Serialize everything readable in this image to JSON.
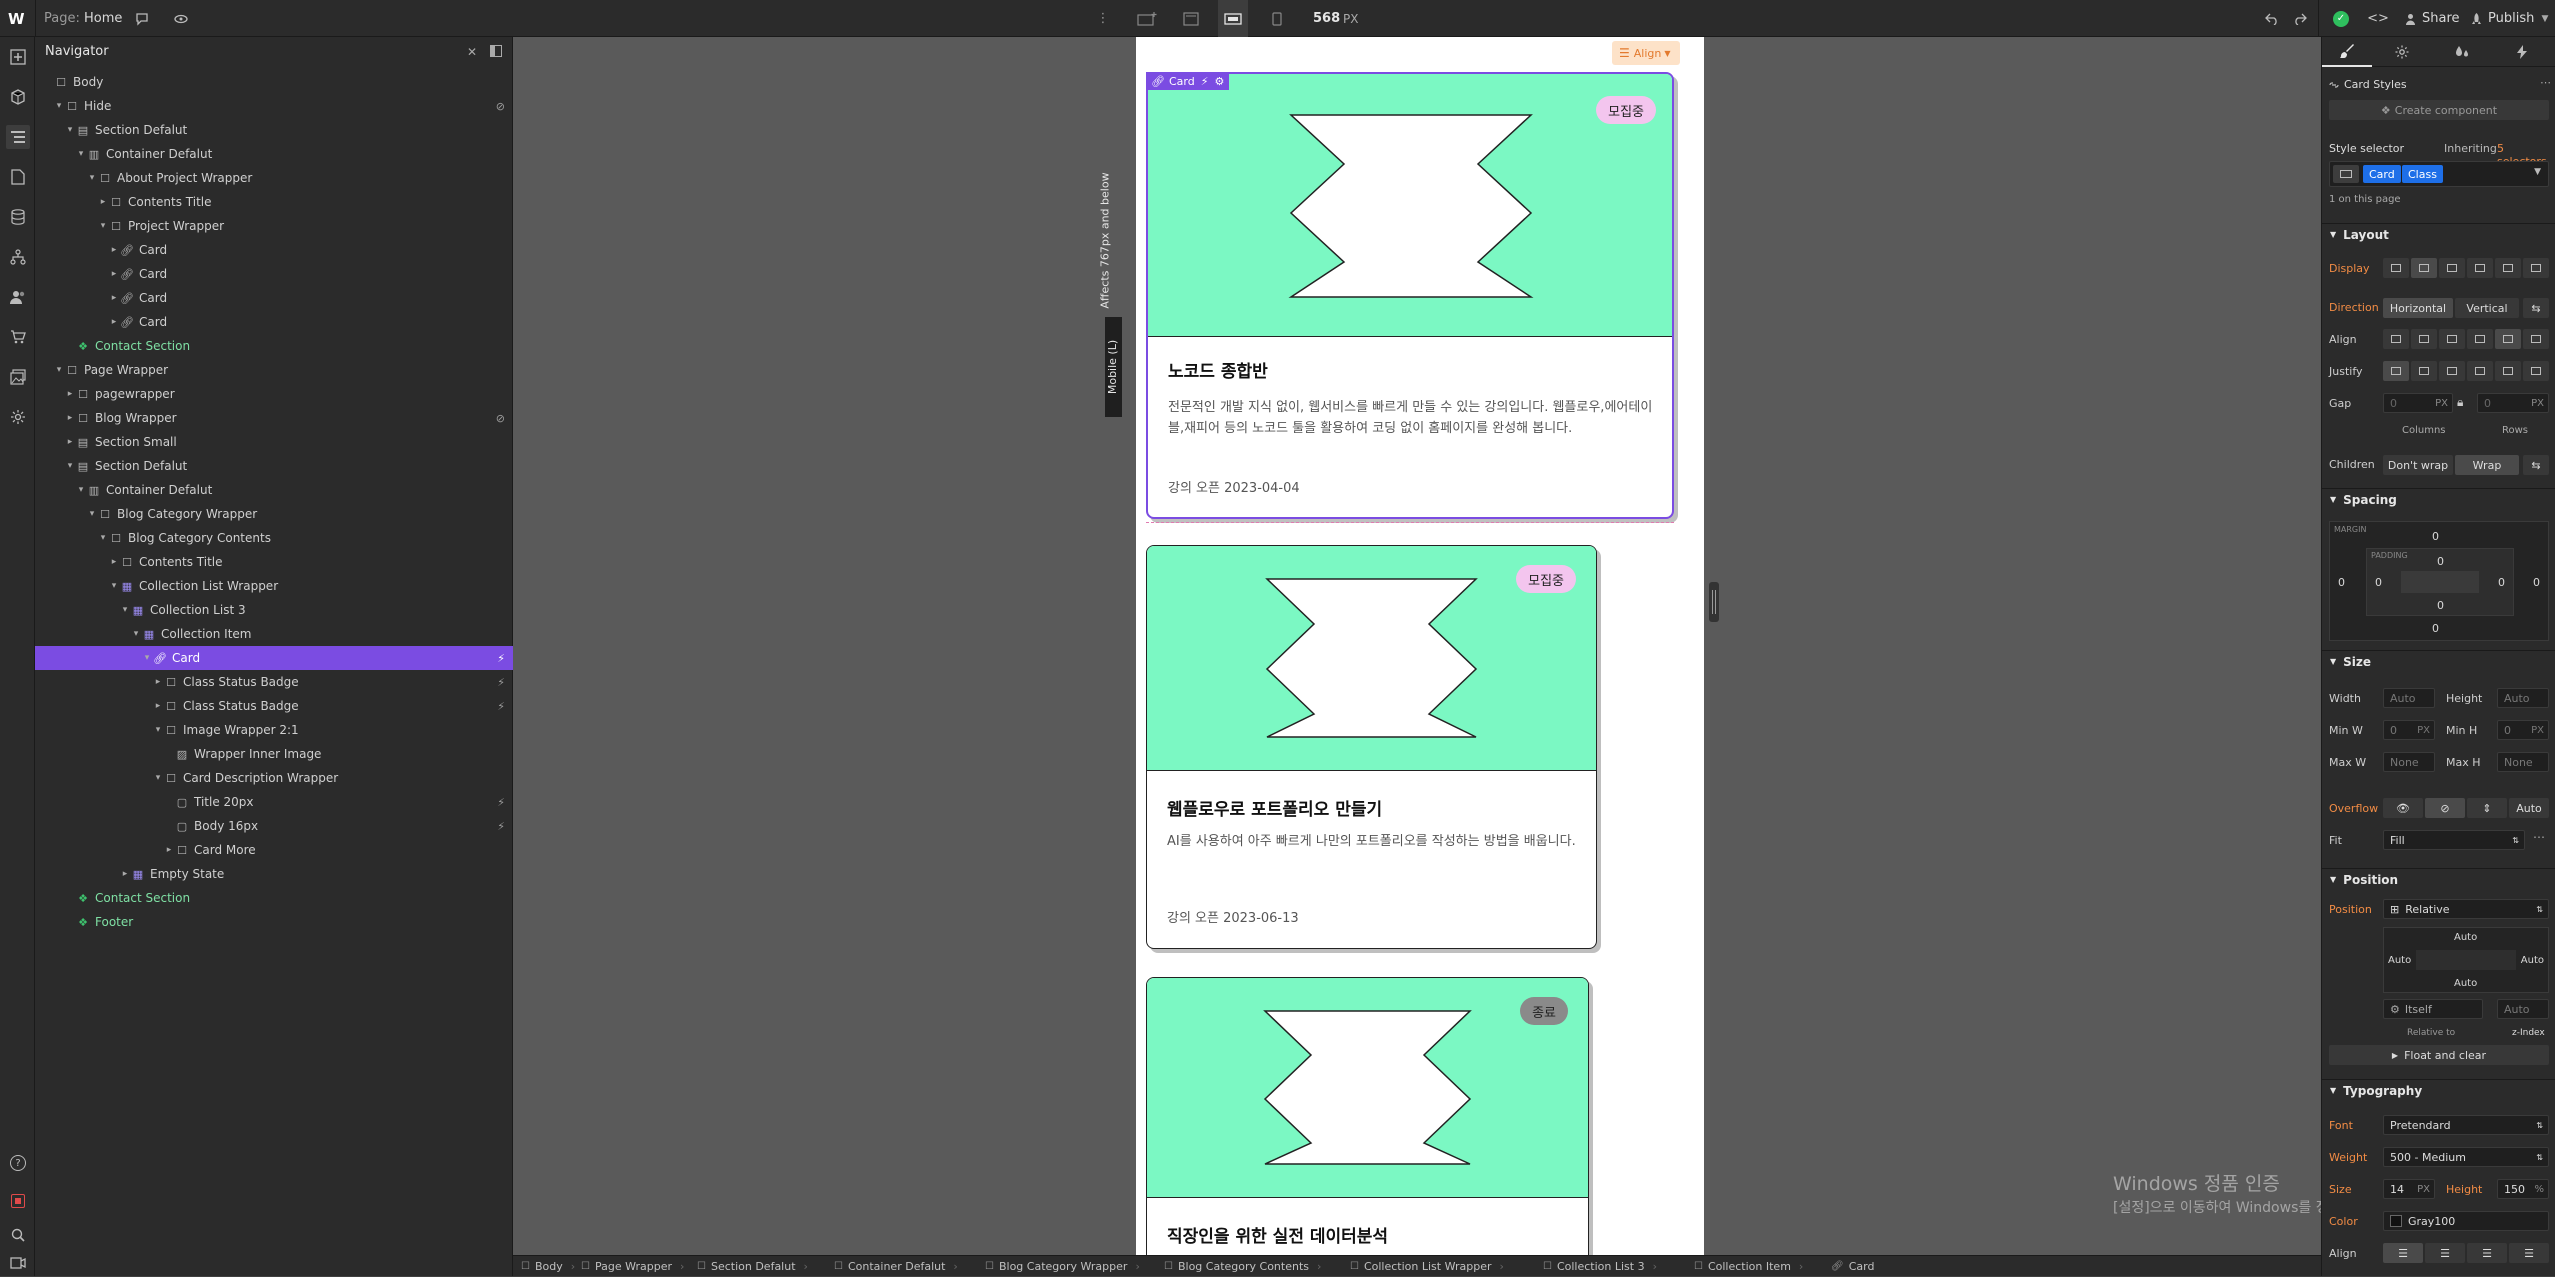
{
  "topbar": {
    "logo": "W",
    "page_prefix": "Page:",
    "page_name": "Home",
    "width_value": "568",
    "width_unit": "PX",
    "share_label": "Share",
    "publish_label": "Publish"
  },
  "navigator": {
    "title": "Navigator",
    "items": [
      {
        "label": "Body",
        "depth": 0,
        "type": "box"
      },
      {
        "label": "Hide",
        "depth": 1,
        "type": "box",
        "open": true,
        "hidden": true
      },
      {
        "label": "Section Defalut",
        "depth": 2,
        "type": "section",
        "open": true
      },
      {
        "label": "Container Defalut",
        "depth": 3,
        "type": "container",
        "open": true
      },
      {
        "label": "About Project Wrapper",
        "depth": 4,
        "type": "box",
        "open": true
      },
      {
        "label": "Contents Title",
        "depth": 5,
        "type": "box",
        "closed": true
      },
      {
        "label": "Project Wrapper",
        "depth": 5,
        "type": "box",
        "open": true
      },
      {
        "label": "Card",
        "depth": 6,
        "type": "link",
        "closed": true
      },
      {
        "label": "Card",
        "depth": 6,
        "type": "link",
        "closed": true
      },
      {
        "label": "Card",
        "depth": 6,
        "type": "link",
        "closed": true
      },
      {
        "label": "Card",
        "depth": 6,
        "type": "link",
        "closed": true
      },
      {
        "label": "Contact Section",
        "depth": 2,
        "type": "symbol"
      },
      {
        "label": "Page Wrapper",
        "depth": 1,
        "type": "box",
        "open": true
      },
      {
        "label": "pagewrapper",
        "depth": 2,
        "type": "box",
        "closed": true
      },
      {
        "label": "Blog Wrapper",
        "depth": 2,
        "type": "box",
        "closed": true,
        "hidden": true
      },
      {
        "label": "Section Small",
        "depth": 2,
        "type": "section",
        "closed": true
      },
      {
        "label": "Section Defalut",
        "depth": 2,
        "type": "section",
        "open": true
      },
      {
        "label": "Container Defalut",
        "depth": 3,
        "type": "container",
        "open": true
      },
      {
        "label": "Blog Category Wrapper",
        "depth": 4,
        "type": "box",
        "open": true
      },
      {
        "label": "Blog Category Contents",
        "depth": 5,
        "type": "box",
        "open": true
      },
      {
        "label": "Contents Title",
        "depth": 6,
        "type": "box",
        "closed": true
      },
      {
        "label": "Collection List Wrapper",
        "depth": 6,
        "type": "collection",
        "open": true
      },
      {
        "label": "Collection List 3",
        "depth": 7,
        "type": "collection",
        "open": true
      },
      {
        "label": "Collection Item",
        "depth": 8,
        "type": "collection",
        "open": true
      },
      {
        "label": "Card",
        "depth": 9,
        "type": "link",
        "open": true,
        "selected": true,
        "flag": true
      },
      {
        "label": "Class Status Badge",
        "depth": 10,
        "type": "box",
        "closed": true,
        "flag": true
      },
      {
        "label": "Class Status Badge",
        "depth": 10,
        "type": "box",
        "closed": true,
        "flag": true
      },
      {
        "label": "Image Wrapper 2:1",
        "depth": 10,
        "type": "box",
        "open": true
      },
      {
        "label": "Wrapper Inner Image",
        "depth": 11,
        "type": "image"
      },
      {
        "label": "Card Description Wrapper",
        "depth": 10,
        "type": "box",
        "open": true
      },
      {
        "label": "Title 20px",
        "depth": 11,
        "type": "text",
        "flag": true
      },
      {
        "label": "Body 16px",
        "depth": 11,
        "type": "text",
        "flag": true
      },
      {
        "label": "Card More",
        "depth": 11,
        "type": "box",
        "closed": true
      },
      {
        "label": "Empty State",
        "depth": 7,
        "type": "collection",
        "closed": true
      },
      {
        "label": "Contact Section",
        "depth": 2,
        "type": "symbol"
      },
      {
        "label": "Footer",
        "depth": 2,
        "type": "symbol"
      }
    ]
  },
  "canvas": {
    "affects_label": "Affects 767px and below",
    "breakpoint_label": "Mobile (L)",
    "align_label": "Align",
    "selected_tag": "Card",
    "cards": [
      {
        "badge": "모집중",
        "badge_color": "#f3c5ee",
        "title": "노코드 종합반",
        "desc_lines": [
          "전문적인 개발 지식 없이, 웹서비스를 빠르게 만들 수 있는 강의입니다. 웹플로우,에어테이",
          "블,재피어 등의 노코드 툴을 활용하여 코딩 없이 홈페이지를 완성해 봅니다."
        ],
        "date": "강의 오픈 2023-04-04"
      },
      {
        "badge": "모집중",
        "badge_color": "#f3c5ee",
        "title": "웹플로우로 포트폴리오 만들기",
        "desc_lines": [
          "AI를 사용하여 아주 빠르게 나만의 포트폴리오를 작성하는 방법을 배웁니다."
        ],
        "date": "강의 오픈 2023-06-13"
      },
      {
        "badge": "종료",
        "badge_color": "#8a8a8a",
        "title": "직장인을 위한 실전 데이터분석",
        "desc_lines": [],
        "date": ""
      }
    ]
  },
  "style_panel": {
    "header": "Card Styles",
    "create_component": "Create component",
    "style_selector_label": "Style selector",
    "inheriting_prefix": "Inheriting",
    "inheriting_count": "5 selectors",
    "tag_card": "Card",
    "tag_class": "Class",
    "on_page": "1 on this page",
    "layout": {
      "title": "Layout",
      "display_label": "Display",
      "direction_label": "Direction",
      "direction_h": "Horizontal",
      "direction_v": "Vertical",
      "align_label": "Align",
      "justify_label": "Justify",
      "gap_label": "Gap",
      "gap_unit": "PX",
      "columns_label": "Columns",
      "rows_label": "Rows",
      "children_label": "Children",
      "dont_wrap": "Don't wrap",
      "wrap": "Wrap"
    },
    "spacing": {
      "title": "Spacing",
      "margin_label": "MARGIN",
      "padding_label": "PADDING",
      "zero": "0"
    },
    "size": {
      "title": "Size",
      "width_label": "Width",
      "height_label": "Height",
      "minw_label": "Min W",
      "minh_label": "Min H",
      "maxw_label": "Max W",
      "maxh_label": "Max H",
      "auto": "Auto",
      "none": "None",
      "zero": "0",
      "px": "PX",
      "overflow_label": "Overflow",
      "overflow_auto": "Auto",
      "fit_label": "Fit",
      "fit_value": "Fill"
    },
    "position": {
      "title": "Position",
      "position_label": "Position",
      "position_value": "Relative",
      "auto": "Auto",
      "itself": "Itself",
      "relative_to": "Relative to",
      "zindex": "z-Index",
      "float_clear": "Float and clear"
    },
    "typography": {
      "title": "Typography",
      "font_label": "Font",
      "font_value": "Pretendard",
      "weight_label": "Weight",
      "weight_value": "500 - Medium",
      "size_label": "Size",
      "size_value": "14",
      "size_unit": "PX",
      "height_label": "Height",
      "height_value": "150",
      "height_unit": "%",
      "color_label": "Color",
      "color_value": "Gray100",
      "align_label": "Align"
    }
  },
  "breadcrumbs": [
    "Body",
    "Page Wrapper",
    "Section Defalut",
    "Container Defalut",
    "Blog Category Wrapper",
    "Blog Category Contents",
    "Collection List Wrapper",
    "Collection List 3",
    "Collection Item",
    "Card"
  ],
  "watermark": {
    "title": "Windows 정품 인증",
    "subtitle": "[설정]으로 이동하여 Windows를 정품 인증합니다."
  },
  "colors": {
    "accent": "#7b4ce2",
    "card_image": "#7bf8c3",
    "selection_blue": "#1e6fe8",
    "orange_label": "#f28c45"
  }
}
